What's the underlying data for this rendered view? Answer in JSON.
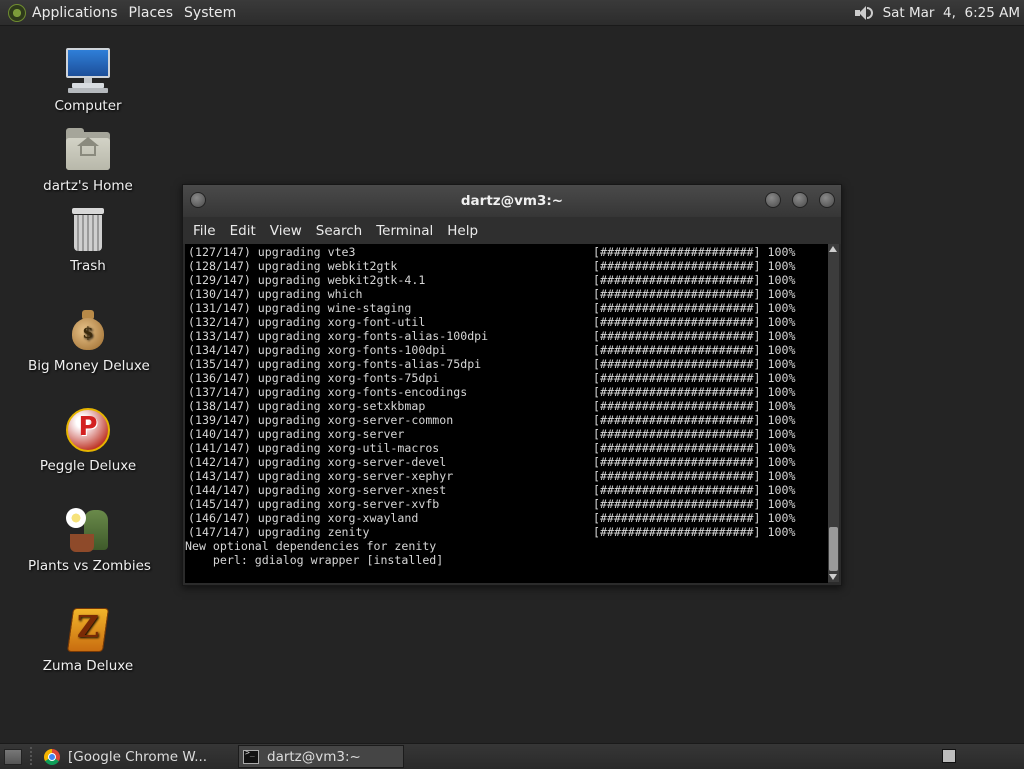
{
  "top_panel": {
    "menus": [
      "Applications",
      "Places",
      "System"
    ],
    "datetime": "Sat Mar  4,  6:25 AM"
  },
  "desktop_icons": [
    {
      "label": "Computer",
      "icon": "computer-icon"
    },
    {
      "label": "dartz's Home",
      "icon": "home-folder-icon"
    },
    {
      "label": "Trash",
      "icon": "trash-icon"
    },
    {
      "label": "Big Money Deluxe",
      "icon": "money-bag-icon"
    },
    {
      "label": "Peggle Deluxe",
      "icon": "peggle-icon"
    },
    {
      "label": "Plants vs Zombies",
      "icon": "plants-vs-zombies-icon"
    },
    {
      "label": "Zuma Deluxe",
      "icon": "zuma-icon"
    }
  ],
  "terminal": {
    "title": "dartz@vm3:~",
    "menu": [
      "File",
      "Edit",
      "View",
      "Search",
      "Terminal",
      "Help"
    ],
    "progress_bar": "[######################]",
    "percent": "100%",
    "lines": [
      "(127/147) upgrading vte3",
      "(128/147) upgrading webkit2gtk",
      "(129/147) upgrading webkit2gtk-4.1",
      "(130/147) upgrading which",
      "(131/147) upgrading wine-staging",
      "(132/147) upgrading xorg-font-util",
      "(133/147) upgrading xorg-fonts-alias-100dpi",
      "(134/147) upgrading xorg-fonts-100dpi",
      "(135/147) upgrading xorg-fonts-alias-75dpi",
      "(136/147) upgrading xorg-fonts-75dpi",
      "(137/147) upgrading xorg-fonts-encodings",
      "(138/147) upgrading xorg-setxkbmap",
      "(139/147) upgrading xorg-server-common",
      "(140/147) upgrading xorg-server",
      "(141/147) upgrading xorg-util-macros",
      "(142/147) upgrading xorg-server-devel",
      "(143/147) upgrading xorg-server-xephyr",
      "(144/147) upgrading xorg-server-xnest",
      "(145/147) upgrading xorg-server-xvfb",
      "(146/147) upgrading xorg-xwayland",
      "(147/147) upgrading zenity"
    ],
    "footer_lines": [
      "New optional dependencies for zenity",
      "    perl: gdialog wrapper [installed]"
    ]
  },
  "taskbar": {
    "tasks": [
      {
        "label": "[Google Chrome W...",
        "icon": "chrome-icon",
        "active": false
      },
      {
        "label": "dartz@vm3:~",
        "icon": "terminal-icon",
        "active": true
      }
    ]
  }
}
